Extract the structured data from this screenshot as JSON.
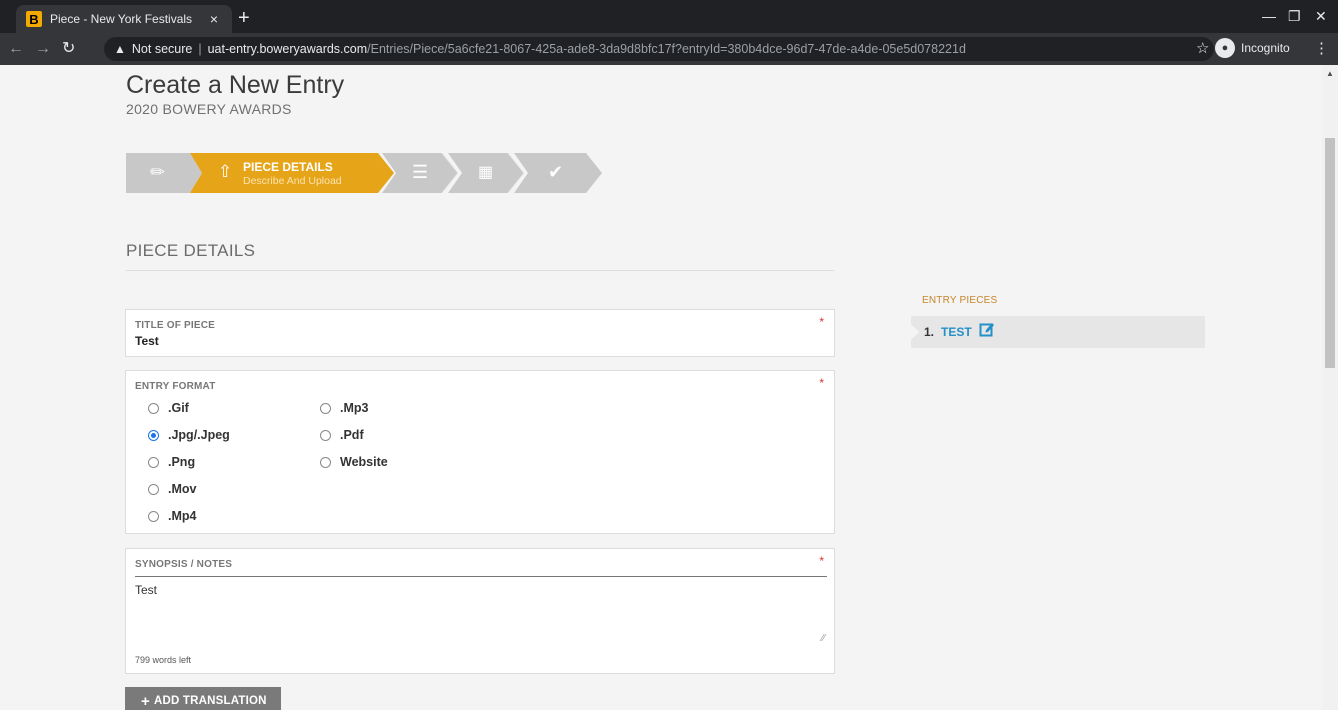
{
  "browser": {
    "tab_favicon": "B",
    "tab_title": "Piece - New York Festivals",
    "tab_close": "×",
    "new_tab": "+",
    "security_label": "Not secure",
    "separator": "|",
    "url_host": "uat-entry.boweryawards.com",
    "url_path": "/Entries/Piece/5a6cfe21-8067-425a-ade8-3da9d8bfc17f?entryId=380b4dce-96d7-47de-a4de-05e5d078221d",
    "incognito_label": "Incognito"
  },
  "page": {
    "title": "Create a New Entry",
    "subtitle": "2020 BOWERY AWARDS"
  },
  "wizard": {
    "active_step_title": "PIECE DETAILS",
    "active_step_desc": "Describe And Upload",
    "colors": {
      "active": "#e6a418",
      "inactive": "#c8c8c8"
    }
  },
  "section": {
    "heading": "PIECE DETAILS"
  },
  "title_field": {
    "label": "TITLE OF PIECE",
    "value": "Test",
    "required_mark": "*"
  },
  "format_field": {
    "label": "ENTRY FORMAT",
    "required_mark": "*",
    "options": [
      ".Gif",
      ".Jpg/.Jpeg",
      ".Png",
      ".Mov",
      ".Mp4",
      ".Mp3",
      ".Pdf",
      "Website"
    ],
    "selected": ".Jpg/.Jpeg"
  },
  "synopsis_field": {
    "label": "SYNOPSIS / NOTES",
    "required_mark": "*",
    "value": "Test",
    "words_left": "799 words left"
  },
  "add_translation": {
    "plus": "+",
    "label": "ADD TRANSLATION"
  },
  "entry_pieces": {
    "label": "ENTRY PIECES",
    "items": [
      {
        "number": "1.",
        "name": "TEST"
      }
    ]
  }
}
